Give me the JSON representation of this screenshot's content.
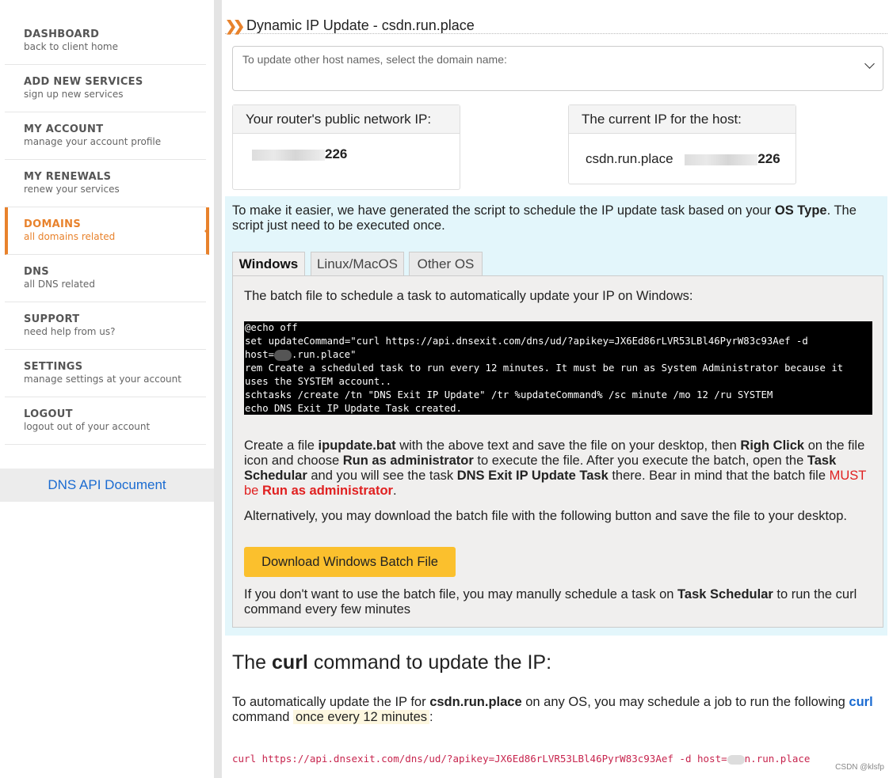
{
  "sidebar": {
    "items": [
      {
        "title": "DASHBOARD",
        "sub": "back to client home"
      },
      {
        "title": "ADD NEW SERVICES",
        "sub": "sign up new services"
      },
      {
        "title": "MY ACCOUNT",
        "sub": "manage your account profile"
      },
      {
        "title": "MY RENEWALS",
        "sub": "renew your services"
      },
      {
        "title": "DOMAINS",
        "sub": "all domains related"
      },
      {
        "title": "DNS",
        "sub": "all DNS related"
      },
      {
        "title": "SUPPORT",
        "sub": "need help from us?"
      },
      {
        "title": "SETTINGS",
        "sub": "manage settings at your account"
      },
      {
        "title": "LOGOUT",
        "sub": "logout out of your account"
      }
    ],
    "active_index": 4,
    "api_doc": "DNS API Document"
  },
  "header": {
    "icon": "double-chevron-right-icon",
    "title": "Dynamic IP Update - csdn.run.place"
  },
  "domain_select": {
    "placeholder": "To update other host names, select the domain name:"
  },
  "router_card": {
    "title": "Your router's public network IP:",
    "ip_suffix": "226"
  },
  "current_card": {
    "title": "The current IP for the host:",
    "host": "csdn.run.place",
    "ip_suffix": "226"
  },
  "info": {
    "intro_1": "To make it easier, we have generated the script to schedule the IP update task based on your ",
    "intro_b": "OS Type",
    "intro_2": ". The script just need to be executed once."
  },
  "tabs": [
    "Windows",
    "Linux/MacOS",
    "Other OS"
  ],
  "windows": {
    "desc": "The batch file to schedule a task to automatically update your IP on Windows:",
    "code_l1": "@echo off",
    "code_l2": "set updateCommand=\"curl https://api.dnsexit.com/dns/ud/?apikey=JX6Ed86rLVR53LBl46PyrW83c93Aef -d",
    "code_l3a": "host=",
    "code_l3b": ".run.place\"",
    "code_l4": "rem Create a scheduled task to run every 12 minutes. It must be run as System Administrator because it",
    "code_l5": "uses the SYSTEM account..",
    "code_l6": "schtasks /create /tn \"DNS Exit IP Update\" /tr %updateCommand% /sc minute /mo 12 /ru SYSTEM",
    "code_l7": "echo DNS Exit IP Update Task created.",
    "p1": [
      "Create a file ",
      "ipupdate.bat",
      " with the above text and save the file on your desktop, then ",
      "Righ Click",
      " on the file icon and choose ",
      "Run as administrator",
      " to execute the file. After you execute the batch, open the ",
      "Task Schedular",
      " and you will see the task ",
      "DNS Exit IP Update Task",
      " there. Bear in mind that the batch file ",
      "MUST be ",
      "Run as administrator",
      "."
    ],
    "p2": "Alternatively, you may download the batch file with the following button and save the file to your desktop.",
    "button": "Download Windows Batch File",
    "p3a": "If you don't want to use the batch file, you may manully schedule a task on ",
    "p3b": "Task Schedular",
    "p3c": " to run the curl command every few minutes"
  },
  "curl_section": {
    "h_a": "The ",
    "h_b": "curl",
    "h_c": " command to update the IP:",
    "p_a": "To automatically update the IP for ",
    "p_b": "csdn.run.place",
    "p_c": " on any OS, you may schedule a job to run the following ",
    "p_d": "curl",
    "p_e": " command ",
    "p_f": "once every 12 minutes",
    "p_g": ":",
    "cmd_a": "curl https://api.dnsexit.com/dns/ud/?apikey=JX6Ed86rLVR53LBl46PyrW83c93Aef -d host=",
    "cmd_b": "n.run.place"
  },
  "watermark": "CSDN @klsfp",
  "colors": {
    "accent": "#e8822c",
    "link": "#1a6bd1",
    "button": "#fbc02d",
    "info_bg": "#e3f6fb",
    "alert": "#e02020"
  }
}
